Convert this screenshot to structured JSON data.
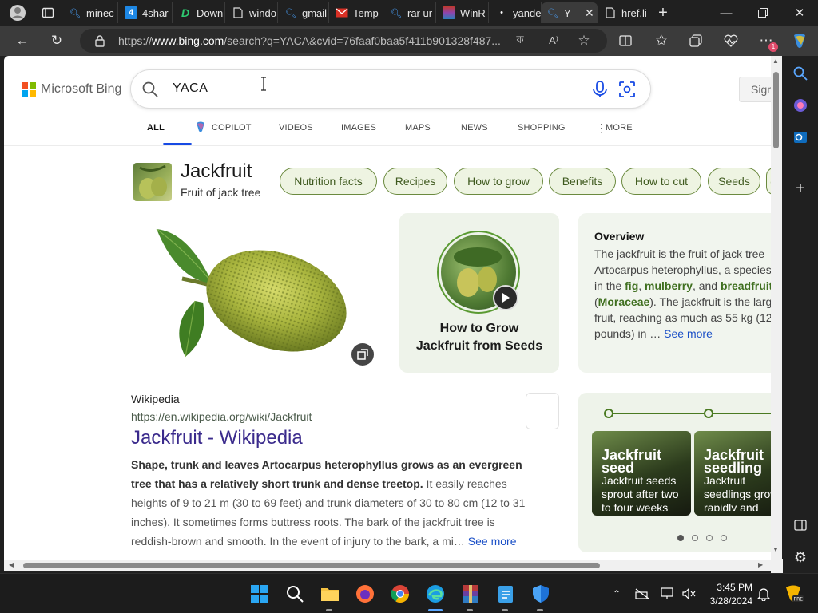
{
  "browser": {
    "tabs": [
      {
        "label": "minec",
        "favicon": "search-icon",
        "color": "#2b7bd6"
      },
      {
        "label": "4shar",
        "favicon": "4shared-icon",
        "color": "#1e88e5"
      },
      {
        "label": "Down",
        "favicon": "download-icon",
        "color": "#2ecc71"
      },
      {
        "label": "windo",
        "favicon": "doc-icon",
        "color": "#cccccc"
      },
      {
        "label": "gmail",
        "favicon": "search-icon",
        "color": "#2b7bd6"
      },
      {
        "label": "Temp",
        "favicon": "mail-icon",
        "color": "#d93025"
      },
      {
        "label": "rar ur",
        "favicon": "search-icon",
        "color": "#2b7bd6"
      },
      {
        "label": "WinR",
        "favicon": "winrar-icon",
        "color": "#8e44ad"
      },
      {
        "label": "yande",
        "favicon": "dot-icon",
        "color": "#ffffff"
      },
      {
        "label": "Y",
        "favicon": "search-icon",
        "color": "#2b7bd6"
      },
      {
        "label": "href.li",
        "favicon": "doc-icon",
        "color": "#cccccc"
      }
    ],
    "address": {
      "scheme": "https://",
      "host": "www.bing.com",
      "path": "/search?q=YACA&cvid=76faaf0baa5f411b901328f487..."
    }
  },
  "bing": {
    "logo_text": "Microsoft Bing",
    "query": "YACA",
    "signin_label": "Sign",
    "scopes": [
      "ALL",
      "COPILOT",
      "VIDEOS",
      "IMAGES",
      "MAPS",
      "NEWS",
      "SHOPPING",
      "MORE"
    ],
    "entity": {
      "title": "Jackfruit",
      "subtitle": "Fruit of jack tree",
      "chips": [
        "Nutrition facts",
        "Recipes",
        "How to grow",
        "Benefits",
        "How to cut",
        "Seeds",
        "("
      ]
    },
    "video": {
      "title_line1": "How to Grow",
      "title_line2": "Jackfruit from Seeds"
    },
    "overview": {
      "heading": "Overview",
      "lines": [
        "The jackfruit is the fruit of jack tree",
        "Artocarpus heterophyllus, a species",
        "in the ",
        "fig",
        ", ",
        "mulberry",
        ", and ",
        "breadfruit",
        " f",
        "(",
        "Moraceae",
        "). The jackfruit is the larg",
        "fruit, reaching as much as 55 kg (12",
        "pounds) in … ",
        "See more"
      ]
    },
    "wiki": {
      "source": "Wikipedia",
      "url": "https://en.wikipedia.org/wiki/Jackfruit",
      "title": "Jackfruit - Wikipedia",
      "snippet_bold": "Shape, trunk and leaves Artocarpus heterophyllus grows as an evergreen tree that has a relatively short trunk and dense treetop.",
      "snippet_rest": " It easily reaches heights of 9 to 21 m (30 to 69 feet) and trunk diameters of 30 to 80 cm (12 to 31 inches). It sometimes forms buttress roots. The bark of the jackfruit tree is reddish-brown and smooth. In the event of injury to the bark, a mi… ",
      "see_more": "See more"
    },
    "timeline": {
      "cards": [
        {
          "title": "Jackfruit seed",
          "desc": "Jackfruit seeds sprout after two to four weeks"
        },
        {
          "title": "Jackfruit seedling",
          "desc": "Jackfruit seedlings grow rapidly and"
        }
      ],
      "pages": 4,
      "active_page": 1
    }
  },
  "taskbar": {
    "time": "3:45 PM",
    "date": "3/28/2024",
    "apps": [
      "windows-start-icon",
      "search-icon",
      "file-explorer-icon",
      "firefox-icon",
      "chrome-icon",
      "edge-icon",
      "winrar-icon",
      "notepad-icon",
      "defender-icon"
    ]
  },
  "colors": {
    "chip_border": "#6b8a3f",
    "chip_bg": "#eef4e2",
    "link_purple": "#3a2a8c",
    "see_more_blue": "#1a4fc7",
    "bing_blue_underline": "#174ae4"
  }
}
